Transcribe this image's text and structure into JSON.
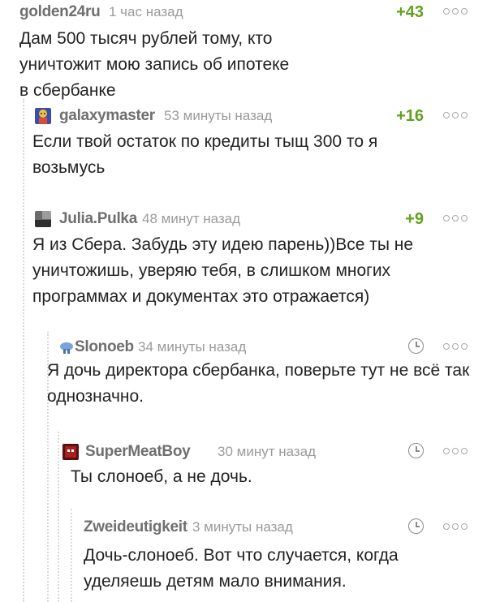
{
  "comments": [
    {
      "username": "golden24ru",
      "time": "1 час назад",
      "rating": "+43",
      "text": "Дам 500 тысяч рублей тому, кто уничтожит мою запись об ипотеке в сбербанке",
      "avatar_icon": "none"
    },
    {
      "username": "galaxymaster",
      "time": "53 минуты назад",
      "rating": "+16",
      "text": "Если твой остаток по кредиты тыщ 300 то я возьмусь",
      "avatar_icon": "cartoon-avatar-icon"
    },
    {
      "username": "Julia.Pulka",
      "time": "48 минут назад",
      "rating": "+9",
      "text": "Я из Сбера. Забудь эту идею парень))Все ты не уничтожишь, уверяю тебя, в слишком многих программах и документах это отражается)",
      "avatar_icon": "photo-avatar-icon"
    },
    {
      "username": "Slonoeb",
      "time": "34 минуты назад",
      "rating": "",
      "text": "Я дочь директора сбербанка, поверьте тут не всё так однозначно.",
      "avatar_icon": "small-creature-avatar-icon"
    },
    {
      "username": "SuperMeatBoy",
      "time": "30 минут назад",
      "rating": "",
      "text": "Ты слоноеб, а не дочь.",
      "avatar_icon": "meat-avatar-icon"
    },
    {
      "username": "Zweideutigkeit",
      "time": "3 минуты назад",
      "rating": "",
      "text": "Дочь-слоноеб. Вот что случается, когда уделяешь детям мало внимания.",
      "avatar_icon": "none"
    }
  ],
  "colors": {
    "rating_positive": "#63a11e",
    "username": "#6f6f6f",
    "time": "#9a9a9a",
    "thread_line": "#d9d9d9"
  }
}
